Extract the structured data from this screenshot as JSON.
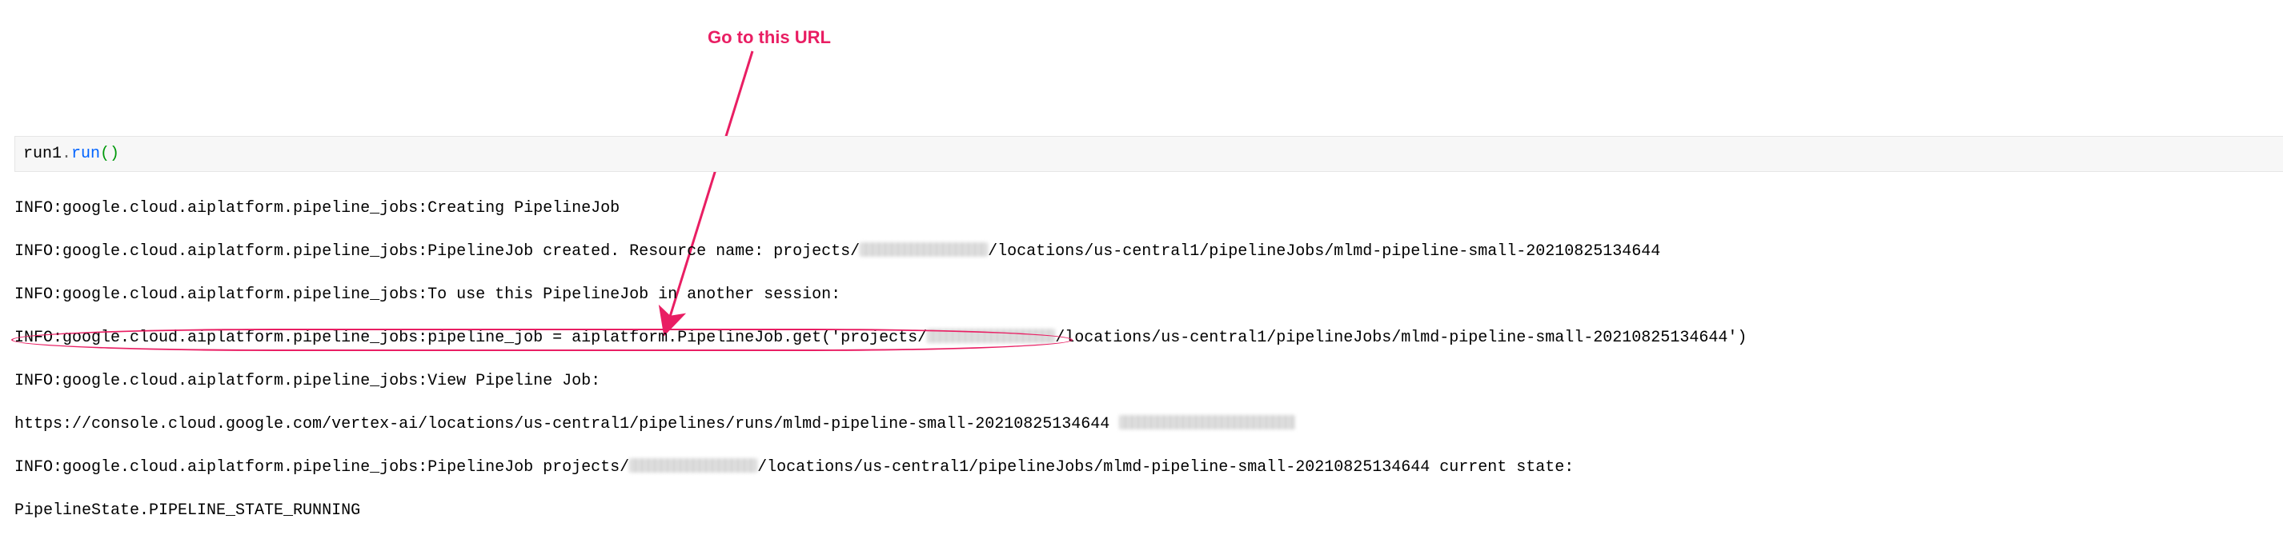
{
  "annotation": {
    "label": "Go to this URL"
  },
  "code": {
    "object": "run1",
    "dot": ".",
    "method": "run",
    "parens": "()"
  },
  "log": {
    "l1": "INFO:google.cloud.aiplatform.pipeline_jobs:Creating PipelineJob",
    "l2a": "INFO:google.cloud.aiplatform.pipeline_jobs:PipelineJob created. Resource name: projects/",
    "l2b": "/locations/us-central1/pipelineJobs/mlmd-pipeline-small-20210825134644",
    "l3": "INFO:google.cloud.aiplatform.pipeline_jobs:To use this PipelineJob in another session:",
    "l4a": "INFO:google.cloud.aiplatform.pipeline_jobs:pipeline_job = aiplatform.PipelineJob.get('projects/",
    "l4b": "/locations/us-central1/pipelineJobs/mlmd-pipeline-small-20210825134644')",
    "l5": "INFO:google.cloud.aiplatform.pipeline_jobs:View Pipeline Job:",
    "l6": "https://console.cloud.google.com/vertex-ai/locations/us-central1/pipelines/runs/mlmd-pipeline-small-20210825134644",
    "l7a": "INFO:google.cloud.aiplatform.pipeline_jobs:PipelineJob projects/",
    "l7b": "/locations/us-central1/pipelineJobs/mlmd-pipeline-small-20210825134644 current state:",
    "l8": "PipelineState.PIPELINE_STATE_RUNNING"
  }
}
